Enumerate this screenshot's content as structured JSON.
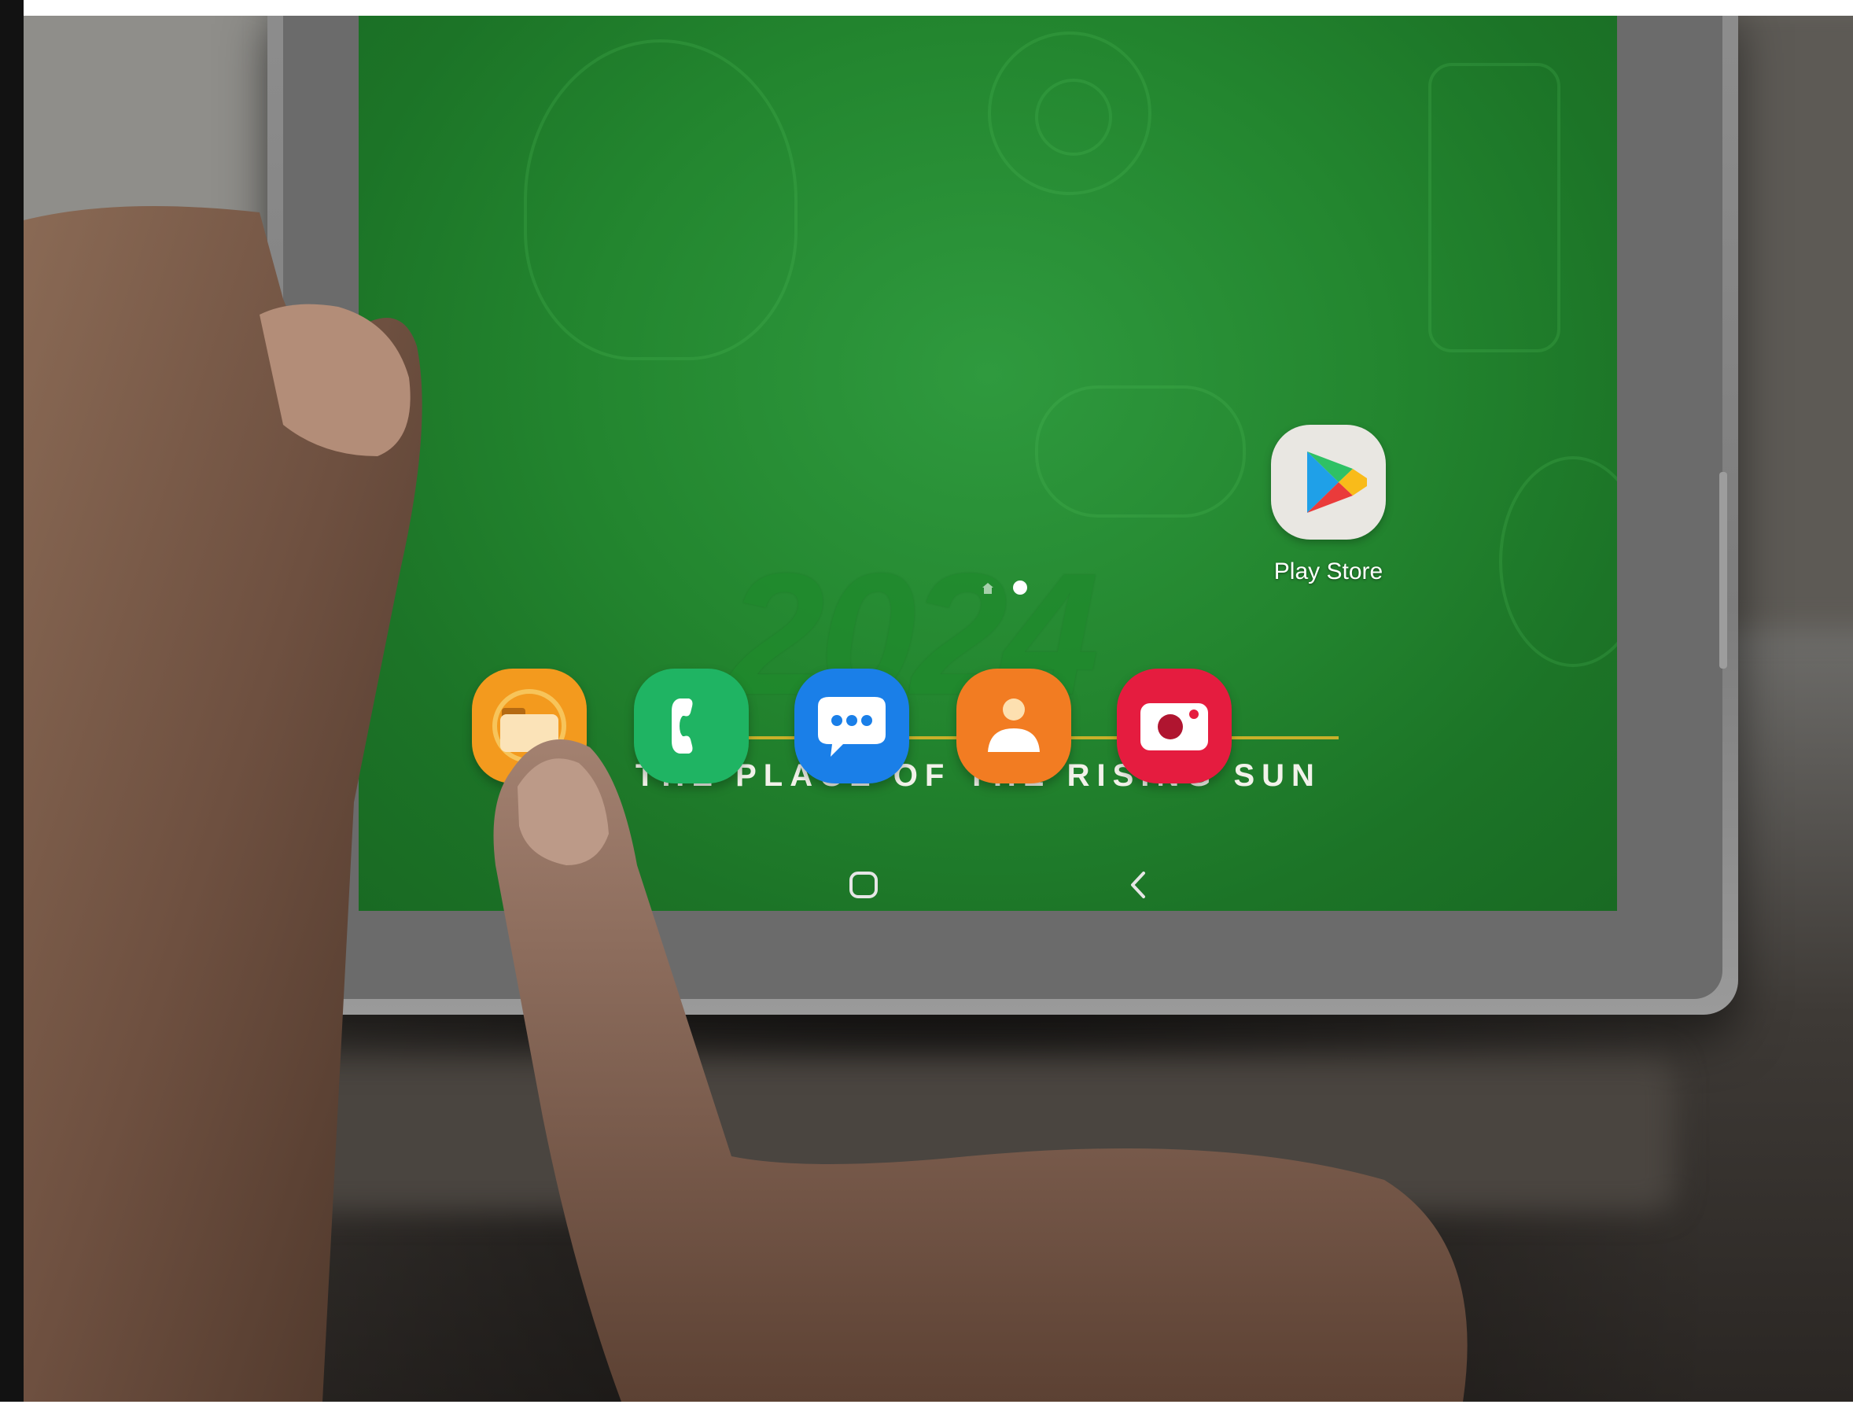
{
  "home_screen": {
    "wallpaper": {
      "year_text": "2024",
      "slogan": "THE PLACE OF THE RISING SUN",
      "accent_color": "#c8b02a",
      "base_color": "#23862f"
    },
    "apps": [
      {
        "label": "Play Store",
        "icon": "play-store-icon"
      }
    ],
    "page_indicator": {
      "pages": 2,
      "active_page": 2
    },
    "dock": [
      {
        "icon": "my-files-icon",
        "color": "#f39a1e"
      },
      {
        "icon": "phone-icon",
        "color": "#1fb463"
      },
      {
        "icon": "messages-icon",
        "color": "#1a7fe8"
      },
      {
        "icon": "contacts-icon",
        "color": "#f27c22"
      },
      {
        "icon": "camera-icon",
        "color": "#e51c3f"
      }
    ],
    "nav_bar": {
      "recents_icon": "recents-icon",
      "home_icon": "home-icon",
      "back_icon": "back-icon"
    }
  }
}
